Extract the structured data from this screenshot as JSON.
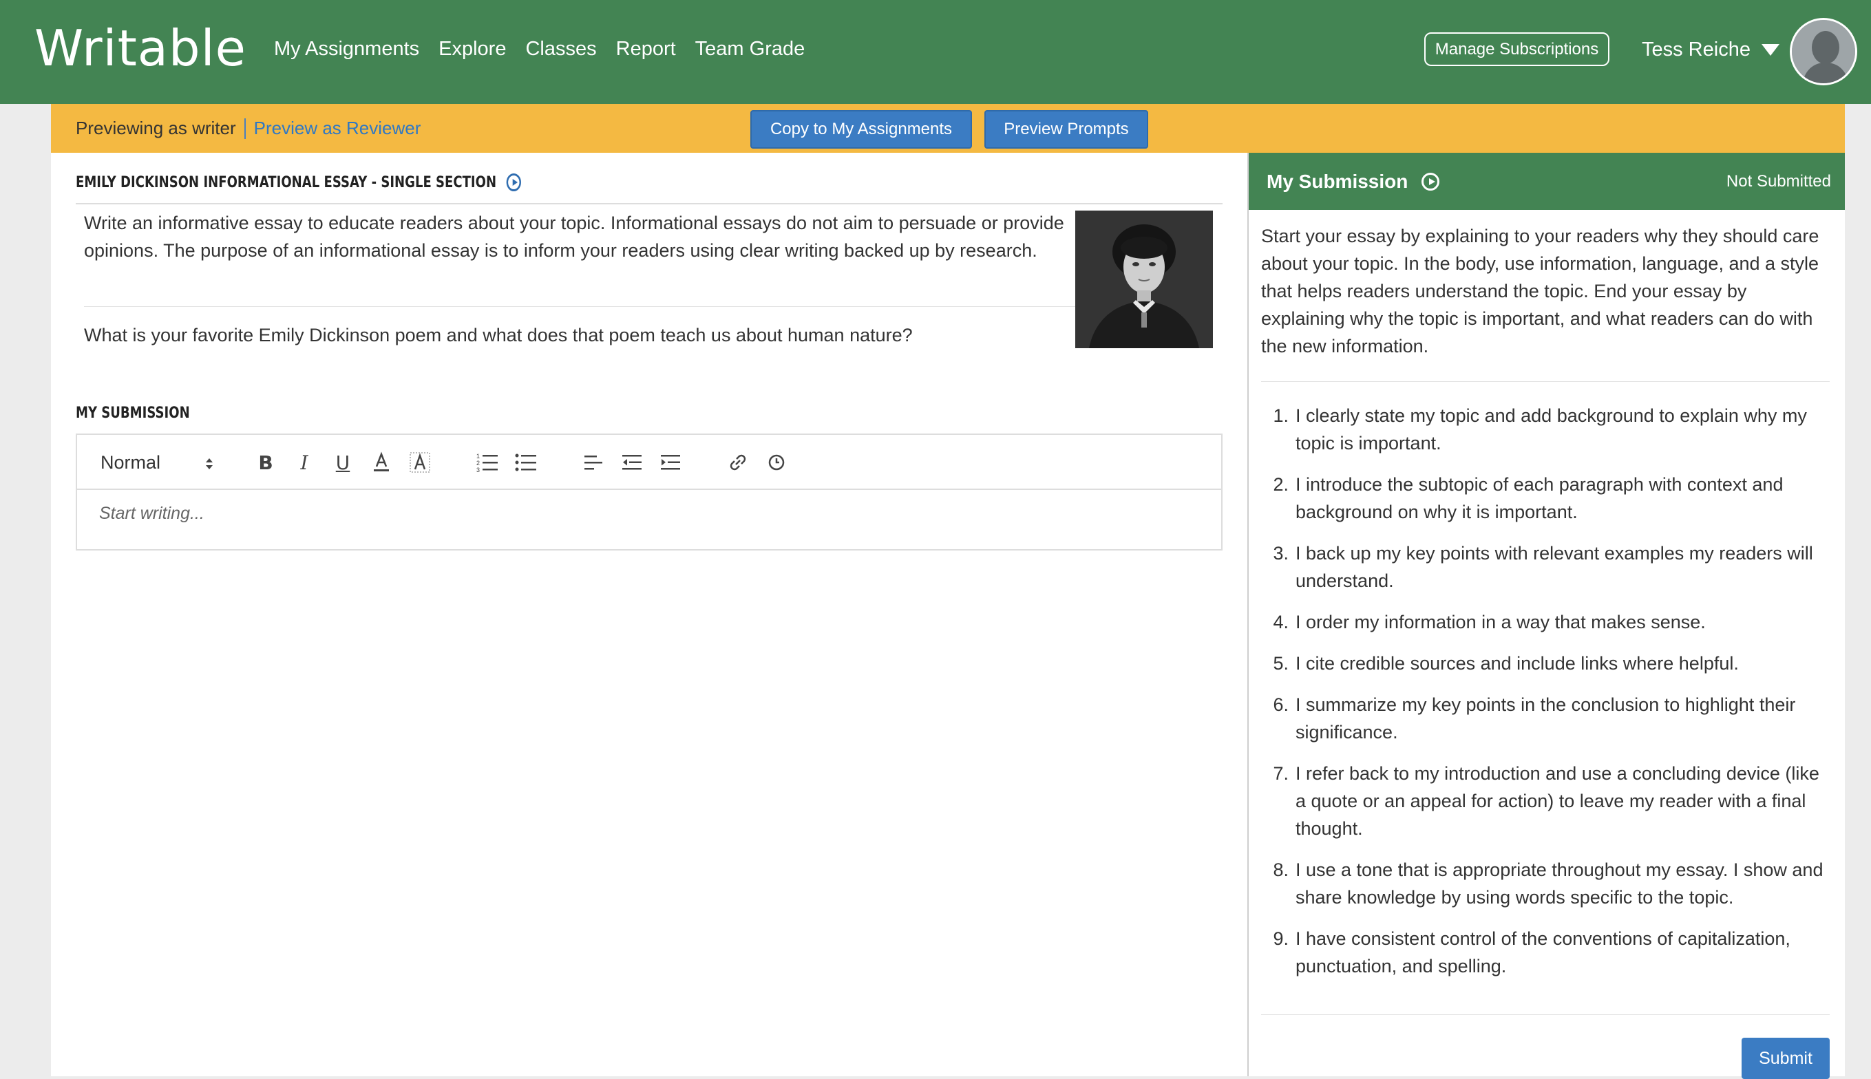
{
  "nav": {
    "logo": "Writable",
    "links": [
      "My Assignments",
      "Explore",
      "Classes",
      "Report",
      "Team Grade"
    ],
    "manage_subscriptions": "Manage Subscriptions",
    "user_name": "Tess Reiche"
  },
  "preview_bar": {
    "previewing_as": "Previewing as writer",
    "preview_as_reviewer": "Preview as Reviewer",
    "copy_button": "Copy to My Assignments",
    "preview_prompts_button": "Preview Prompts"
  },
  "assignment": {
    "title": "EMILY DICKINSON INFORMATIONAL ESSAY - SINGLE SECTION",
    "prompt": "Write an informative essay to educate readers about your topic. Informational essays do not aim to persuade or provide opinions. The purpose of an informational essay is to inform your readers using clear writing backed up by research.",
    "question": "What is your favorite Emily Dickinson poem and what does that poem teach us about human nature?"
  },
  "editor": {
    "label": "MY SUBMISSION",
    "format": "Normal",
    "placeholder": "Start writing..."
  },
  "submission_panel": {
    "title": "My Submission",
    "status": "Not Submitted",
    "intro": "Start your essay by explaining to your readers why they should care about your topic. In the body, use information, language, and a style that helps readers understand the topic. End your essay by explaining why the topic is important, and what readers can do with the new information.",
    "checklist": [
      "I clearly state my topic and add background to explain why my topic is important.",
      "I introduce the subtopic of each paragraph with context and background on why it is important.",
      "I back up my key points with relevant examples my readers will understand.",
      "I order my information in a way that makes sense.",
      "I cite credible sources and include links where helpful.",
      "I summarize my key points in the conclusion to highlight their significance.",
      "I refer back to my introduction and use a concluding device (like a quote or an appeal for action) to leave my reader with a final thought.",
      "I use a tone that is appropriate throughout my essay. I show and share knowledge by using words specific to the topic.",
      "I have consistent control of the conventions of capitalization, punctuation, and spelling."
    ],
    "submit": "Submit"
  },
  "colors": {
    "nav_green": "#438453",
    "preview_yellow": "#f4b942",
    "button_blue": "#3b7cc3",
    "link_blue": "#2f78c4"
  },
  "icons": {
    "play": "play-circle-icon",
    "bold": "bold-icon",
    "italic": "italic-icon",
    "underline": "underline-icon",
    "text_color": "text-color-icon",
    "highlight": "highlight-icon",
    "ordered_list": "ordered-list-icon",
    "bullet_list": "bullet-list-icon",
    "align": "align-left-icon",
    "outdent": "outdent-icon",
    "indent": "indent-icon",
    "link": "link-icon",
    "clock": "clock-icon"
  }
}
